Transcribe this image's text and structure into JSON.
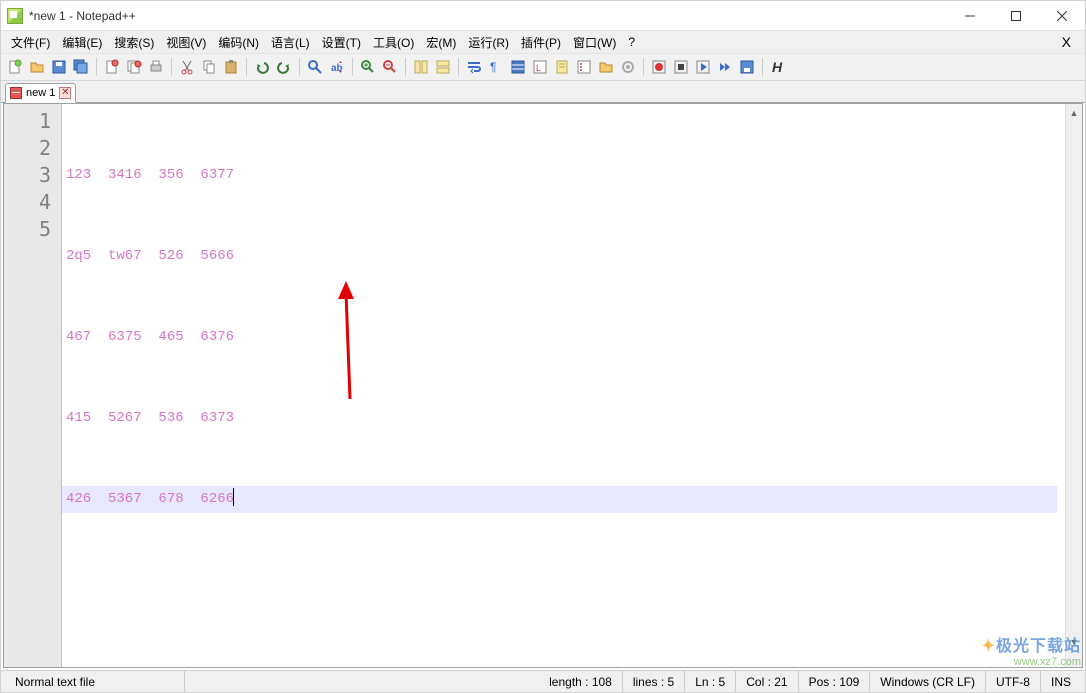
{
  "window": {
    "title": "*new 1 - Notepad++"
  },
  "menu": {
    "items": [
      "文件(F)",
      "编辑(E)",
      "搜索(S)",
      "视图(V)",
      "编码(N)",
      "语言(L)",
      "设置(T)",
      "工具(O)",
      "宏(M)",
      "运行(R)",
      "插件(P)",
      "窗口(W)",
      "?"
    ],
    "right": "X"
  },
  "tab": {
    "label": "new 1"
  },
  "editor": {
    "lines": [
      "123  3416  356  6377",
      "2q5  tw67  526  5666",
      "467  6375  465  6376",
      "415  5267  536  6373",
      "426  5367  678  6266"
    ],
    "current_line_index": 4,
    "line_numbers": [
      "1",
      "2",
      "3",
      "4",
      "5"
    ]
  },
  "status": {
    "filetype": "Normal text file",
    "length_label": "length : 108",
    "lines_label": "lines : 5",
    "ln_label": "Ln : 5",
    "col_label": "Col : 21",
    "pos_label": "Pos : 109",
    "eol": "Windows (CR LF)",
    "encoding": "UTF-8",
    "mode": "INS"
  },
  "watermark": {
    "brand": "极光下载站",
    "url": "www.xz7.com"
  }
}
